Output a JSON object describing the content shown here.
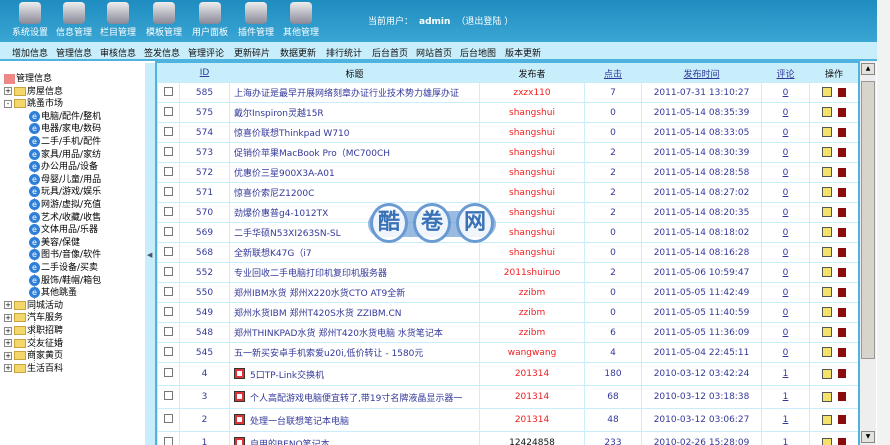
{
  "toolbar": [
    {
      "label": "系统设置",
      "icon": "wrench-icon"
    },
    {
      "label": "信息管理",
      "icon": "documents-icon"
    },
    {
      "label": "栏目管理",
      "icon": "columns-icon"
    },
    {
      "label": "模板管理",
      "icon": "template-icon"
    },
    {
      "label": "用户面板",
      "icon": "users-icon"
    },
    {
      "label": "插件管理",
      "icon": "lifebuoy-icon"
    },
    {
      "label": "其他管理",
      "icon": "play-icon"
    }
  ],
  "user": {
    "label": "当前用户：",
    "name": "admin",
    "logout": "（退出登陆 ）"
  },
  "nav": [
    "增加信息",
    "管理信息",
    "审核信息",
    "签发信息",
    "管理评论",
    "更新碎片",
    "数据更新",
    "排行统计",
    "后台首页",
    "网站首页",
    "后台地图",
    "版本更新"
  ],
  "tree": {
    "root": "管理信息",
    "before": [
      "房屋信息"
    ],
    "open": "跳蚤市场",
    "children": [
      "电脑/配件/整机",
      "电器/家电/数码",
      "二手/手机/配件",
      "家具/用品/家纺",
      "办公用品/设备",
      "母婴/儿童/用品",
      "玩具/游戏/娱乐",
      "网游/虚拟/充值",
      "艺术/收藏/收售",
      "文体用品/乐器",
      "美容/保健",
      "图书/音像/软件",
      "二手设备/买卖",
      "服饰/鞋帽/箱包",
      "其他跳蚤"
    ],
    "after": [
      "同城活动",
      "汽车服务",
      "求职招聘",
      "交友征婚",
      "商家黄页",
      "生活百科"
    ]
  },
  "table": {
    "headers": {
      "id": "ID",
      "title": "标题",
      "author": "发布者",
      "clicks": "点击",
      "time": "发布时间",
      "comments": "评论",
      "ops": "操作"
    },
    "rows": [
      {
        "id": "585",
        "title": "上海办证是最早开展网络刻章办证行业技术势力雄厚办证",
        "author": "zxzx110",
        "clicks": "7",
        "time": "2011-07-31 13:10:27",
        "comments": "0"
      },
      {
        "id": "575",
        "title": "戴尔Inspiron灵越15R",
        "author": "shangshui",
        "clicks": "0",
        "time": "2011-05-14 08:35:39",
        "comments": "0"
      },
      {
        "id": "574",
        "title": "惊喜价联想Thinkpad W710",
        "author": "shangshui",
        "clicks": "0",
        "time": "2011-05-14 08:33:05",
        "comments": "0"
      },
      {
        "id": "573",
        "title": "促销价苹果MacBook Pro（MC700CH",
        "author": "shangshui",
        "clicks": "2",
        "time": "2011-05-14 08:30:39",
        "comments": "0"
      },
      {
        "id": "572",
        "title": "优惠价三星900X3A-A01",
        "author": "shangshui",
        "clicks": "2",
        "time": "2011-05-14 08:28:58",
        "comments": "0"
      },
      {
        "id": "571",
        "title": "惊喜价索尼Z1200C",
        "author": "shangshui",
        "clicks": "2",
        "time": "2011-05-14 08:27:02",
        "comments": "0"
      },
      {
        "id": "570",
        "title": "劲爆价惠普g4-1012TX",
        "author": "shangshui",
        "clicks": "2",
        "time": "2011-05-14 08:20:35",
        "comments": "0"
      },
      {
        "id": "569",
        "title": "二手华硕N53XI263SN-SL",
        "author": "shangshui",
        "clicks": "0",
        "time": "2011-05-14 08:18:02",
        "comments": "0"
      },
      {
        "id": "568",
        "title": "全新联想K47G（i7",
        "author": "shangshui",
        "clicks": "0",
        "time": "2011-05-14 08:16:28",
        "comments": "0"
      },
      {
        "id": "552",
        "title": "专业回收二手电脑打印机复印机服务器",
        "author": "2011shuiruo",
        "clicks": "2",
        "time": "2011-05-06 10:59:47",
        "comments": "0"
      },
      {
        "id": "550",
        "title": "郑州IBM水货 郑州X220水货CTO AT9全新",
        "author": "zzibm",
        "clicks": "0",
        "time": "2011-05-05 11:42:49",
        "comments": "0"
      },
      {
        "id": "549",
        "title": "郑州水货IBM 郑州T420S水货 ZZIBM.CN",
        "author": "zzibm",
        "clicks": "0",
        "time": "2011-05-05 11:40:59",
        "comments": "0"
      },
      {
        "id": "548",
        "title": "郑州THINKPAD水货 郑州T420水货电脑 水货笔记本",
        "author": "zzibm",
        "clicks": "6",
        "time": "2011-05-05 11:36:09",
        "comments": "0"
      },
      {
        "id": "545",
        "title": "五一新买安卓手机索爱u20i,低价转让 - 1580元",
        "author": "wangwang",
        "clicks": "4",
        "time": "2011-05-04 22:45:11",
        "comments": "0"
      },
      {
        "id": "4",
        "title": "5口TP-Link交换机",
        "author": "201314",
        "clicks": "180",
        "time": "2010-03-12 03:42:24",
        "comments": "1",
        "icon": true
      },
      {
        "id": "3",
        "title": "个人高配游戏电脑便宜转了,带19寸名牌液晶显示器一",
        "author": "201314",
        "clicks": "68",
        "time": "2010-03-12 03:18:38",
        "comments": "1",
        "icon": true
      },
      {
        "id": "2",
        "title": "处理一台联想笔记本电脑",
        "author": "201314",
        "clicks": "48",
        "time": "2010-03-12 03:06:27",
        "comments": "1",
        "icon": true
      },
      {
        "id": "1",
        "title": "自用的BENQ笔记本",
        "author": "12424858",
        "clicks": "233",
        "time": "2010-02-26 15:28:09",
        "comments": "1",
        "icon": true,
        "member": true
      }
    ]
  },
  "watermark": [
    "酷",
    "卷",
    "网"
  ]
}
